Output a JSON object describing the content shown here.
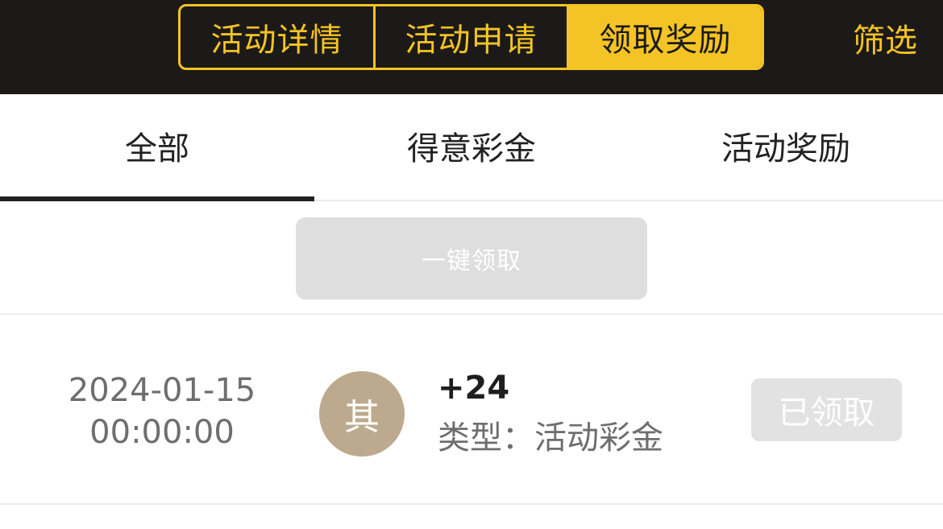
{
  "segment": {
    "items": [
      {
        "label": "活动详情"
      },
      {
        "label": "活动申请"
      },
      {
        "label": "领取奖励"
      }
    ],
    "active_index": 2
  },
  "filter_label": "筛选",
  "tabs": [
    {
      "label": "全部"
    },
    {
      "label": "得意彩金"
    },
    {
      "label": "活动奖励"
    }
  ],
  "active_tab_index": 0,
  "claim_all_label": "一键领取",
  "record": {
    "date": "2024-01-15",
    "time": "00:00:00",
    "avatar_char": "其",
    "amount": "+24",
    "type_label": "类型：",
    "type_value": "活动彩金",
    "status": "已领取"
  },
  "colors": {
    "accent": "#f4c325",
    "topbar_bg": "#1c1a18",
    "avatar_bg": "#bda98d",
    "disabled_btn": "#dedede"
  }
}
